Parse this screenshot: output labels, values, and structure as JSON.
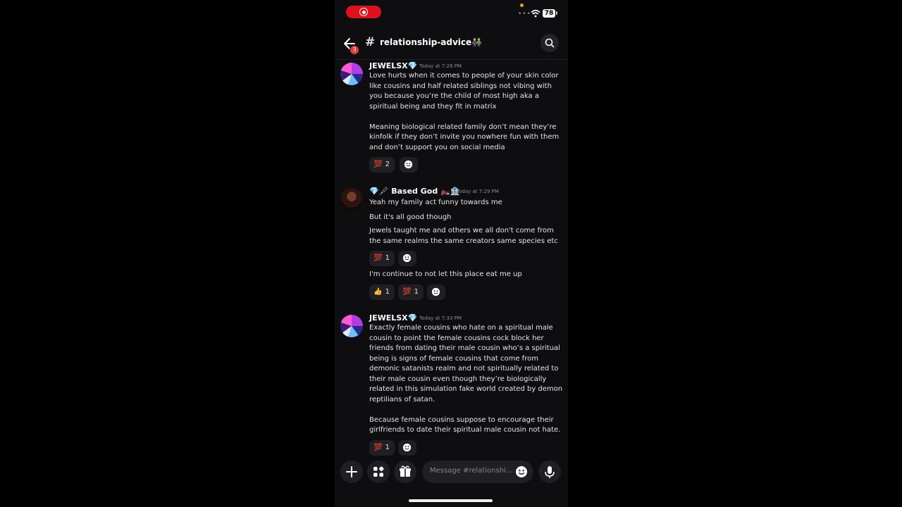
{
  "status_bar": {
    "battery": "78",
    "signal": "••••"
  },
  "header": {
    "channel_hash": "#",
    "channel_name": "relationship-advice👫",
    "chevron": "›",
    "back_badge": "3"
  },
  "messages": [
    {
      "username": "JEWELSX💎",
      "time": "Today at 7:28 PM",
      "avatar": "jewelsx-avatar",
      "text": "Love hurts when it comes to people of your skin color like cousins and half related siblings not vibing with you because you’re the child of most high aka a spiritual being and they fit in matrix\n\nMeaning biological related family don’t mean they’re kinfolk if they don’t invite you nowhere fun with them and don’t support you on social media",
      "reactions": [
        {
          "emoji": "💯",
          "count": "2"
        }
      ]
    },
    {
      "username": "💎🩼 Based God 🏍️🏦",
      "time": "Today at 7:29 PM",
      "avatar": "based-god-avatar",
      "text_1": "Yeah my family act funny towards me",
      "text_2": "But it's all good though",
      "text_3": "Jewels taught me and others we all don't come from the same realms the same creators same species  etc",
      "reactions_1": [
        {
          "emoji": "💯",
          "count": "1"
        }
      ],
      "text_4": "I'm continue to not let this place eat me up",
      "reactions_2": [
        {
          "emoji": "👍",
          "count": "1"
        },
        {
          "emoji": "💯",
          "count": "1"
        }
      ]
    },
    {
      "username": "JEWELSX💎",
      "time": "Today at 7:33 PM",
      "avatar": "jewelsx-avatar",
      "text": "Exactly female cousins who hate on a spiritual male cousin to point the female cousins cock block her friends from dating their male cousin who’s a spiritual being is signs of female cousins that come from demonic satanists realm and not spiritually related to their male cousin even though they’re biologically related in this simulation fake world created by demon reptilians of satan.\n\nBecause female cousins suppose to encourage their girlfriends to date their spiritual male cousin not hate.",
      "reactions": [
        {
          "emoji": "💯",
          "count": "1"
        }
      ]
    }
  ],
  "composer": {
    "placeholder": "Message #relationship-advice👫"
  },
  "colors": {
    "background": "#0e0e10",
    "reaction_bg": "#1f1f24",
    "record_pill": "#e0101c",
    "badge": "#e23a3a"
  }
}
